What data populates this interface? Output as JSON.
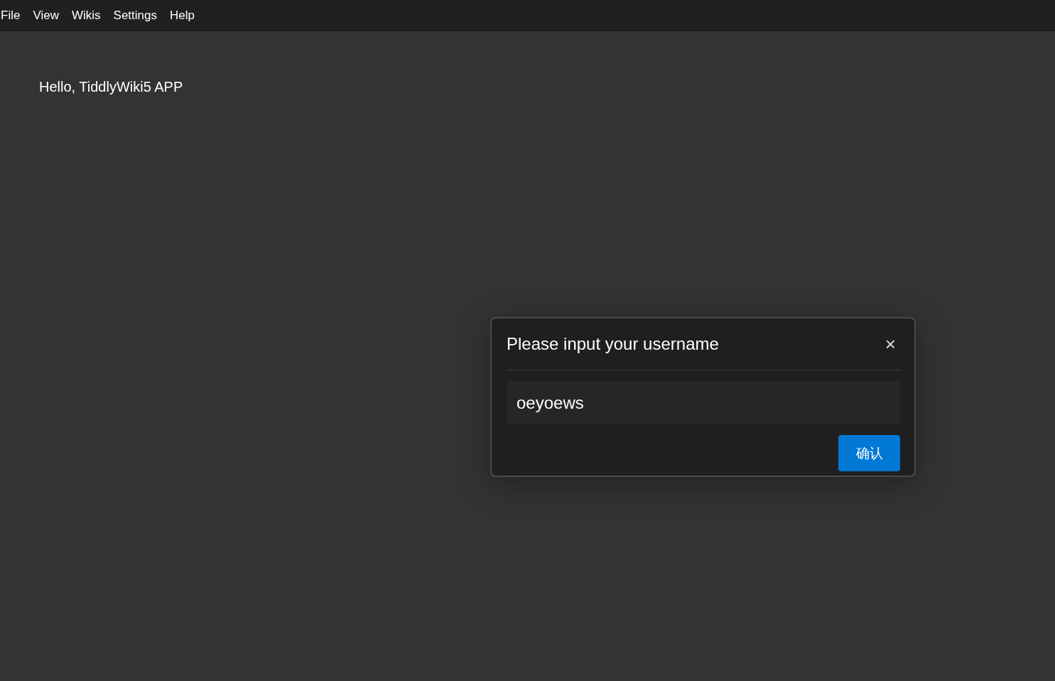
{
  "menu_bar": {
    "items": [
      {
        "label": "File"
      },
      {
        "label": "View"
      },
      {
        "label": "Wikis"
      },
      {
        "label": "Settings"
      },
      {
        "label": "Help"
      }
    ]
  },
  "content": {
    "greeting": "Hello, TiddlyWiki5 APP"
  },
  "dialog": {
    "title": "Please input your username",
    "close_label": "×",
    "input": {
      "value": "oeyoews"
    },
    "confirm_button": "确认"
  }
}
